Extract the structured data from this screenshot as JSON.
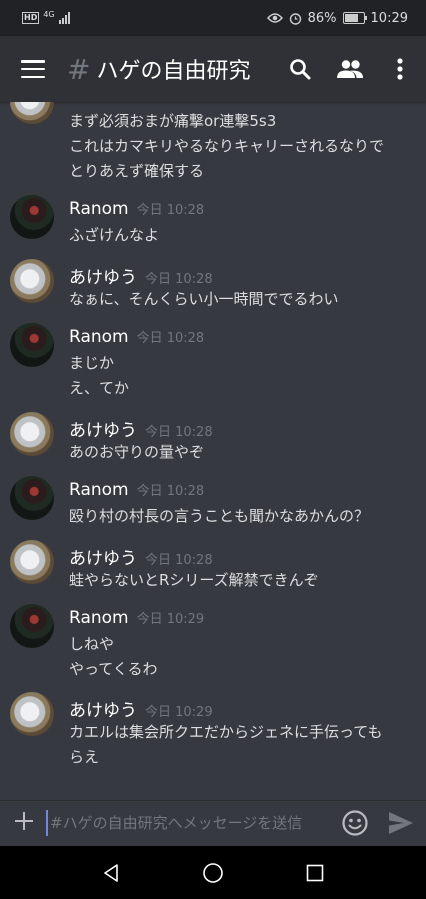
{
  "status_bar": {
    "network_badge": "HD",
    "network_type": "4G",
    "battery_percent": "86%",
    "battery_level": 0.86,
    "time": "10:29"
  },
  "app_bar": {
    "channel_prefix": "#",
    "channel_name": "ハゲの自由研究"
  },
  "messages": [
    {
      "lines": [
        "まず必須おまが痛撃or連撃5s3",
        "これはカマキリやるなりキャリーされるなりで",
        "とりあえず確保する"
      ]
    },
    {
      "author": "Ranom",
      "timestamp": "今日 10:28",
      "lines": [
        "ふざけんなよ"
      ]
    },
    {
      "author": "あけゆう",
      "timestamp": "今日 10:28",
      "lines": [
        "なぁに、そんくらい小一時間ででるわい"
      ]
    },
    {
      "author": "Ranom",
      "timestamp": "今日 10:28",
      "lines": [
        "まじか",
        "え、てか"
      ]
    },
    {
      "author": "あけゆう",
      "timestamp": "今日 10:28",
      "lines": [
        "あのお守りの量やぞ"
      ]
    },
    {
      "author": "Ranom",
      "timestamp": "今日 10:28",
      "lines": [
        "殴り村の村長の言うことも聞かなあかんの？"
      ]
    },
    {
      "author": "あけゆう",
      "timestamp": "今日 10:28",
      "lines": [
        "蛙やらないとRシリーズ解禁できんぞ"
      ]
    },
    {
      "author": "Ranom",
      "timestamp": "今日 10:29",
      "lines": [
        "しねや",
        "やってくるわ"
      ]
    },
    {
      "author": "あけゆう",
      "timestamp": "今日 10:29",
      "lines": [
        "カエルは集会所クエだからジェネに手伝っても",
        "らえ"
      ]
    }
  ],
  "composer": {
    "placeholder": "#ハゲの自由研究へメッセージを送信"
  },
  "colors": {
    "background": "#36393f",
    "app_bar": "#2f3136",
    "timestamp": "#72767d",
    "accent": "#7289da"
  }
}
